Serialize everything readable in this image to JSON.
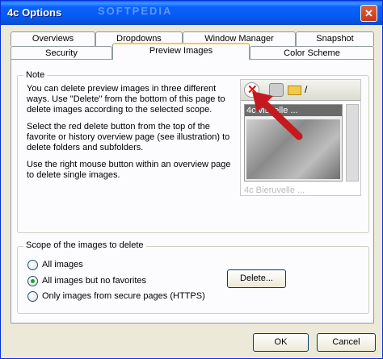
{
  "window": {
    "title": "4c Options",
    "watermark": "SOFTPEDIA"
  },
  "tabs_row1": [
    "Overviews",
    "Dropdowns",
    "Window Manager",
    "Snapshot"
  ],
  "tabs_row2": [
    "Security",
    "Preview Images",
    "Color Scheme"
  ],
  "active_tab": "Preview Images",
  "note": {
    "label": "Note",
    "paragraphs": [
      "You can delete preview images in three different ways. Use \"Delete\" from the bottom of this page to delete images according to the selected scope.",
      "Select the red delete button from the top of the favorite or history overview page (see illustration) to delete folders and subfolders.",
      "Use the right mouse button within an overview page to delete single images."
    ],
    "preview": {
      "thumb1_title": "4c visuelle ...",
      "thumb2_title": "4c Bieruvelle ...",
      "path_sep": "/"
    }
  },
  "scope": {
    "label": "Scope of the images to delete",
    "options": [
      "All images",
      "All images but no favorites",
      "Only images from secure pages (HTTPS)"
    ],
    "selected_index": 1,
    "delete_button": "Delete..."
  },
  "footer": {
    "ok": "OK",
    "cancel": "Cancel"
  }
}
